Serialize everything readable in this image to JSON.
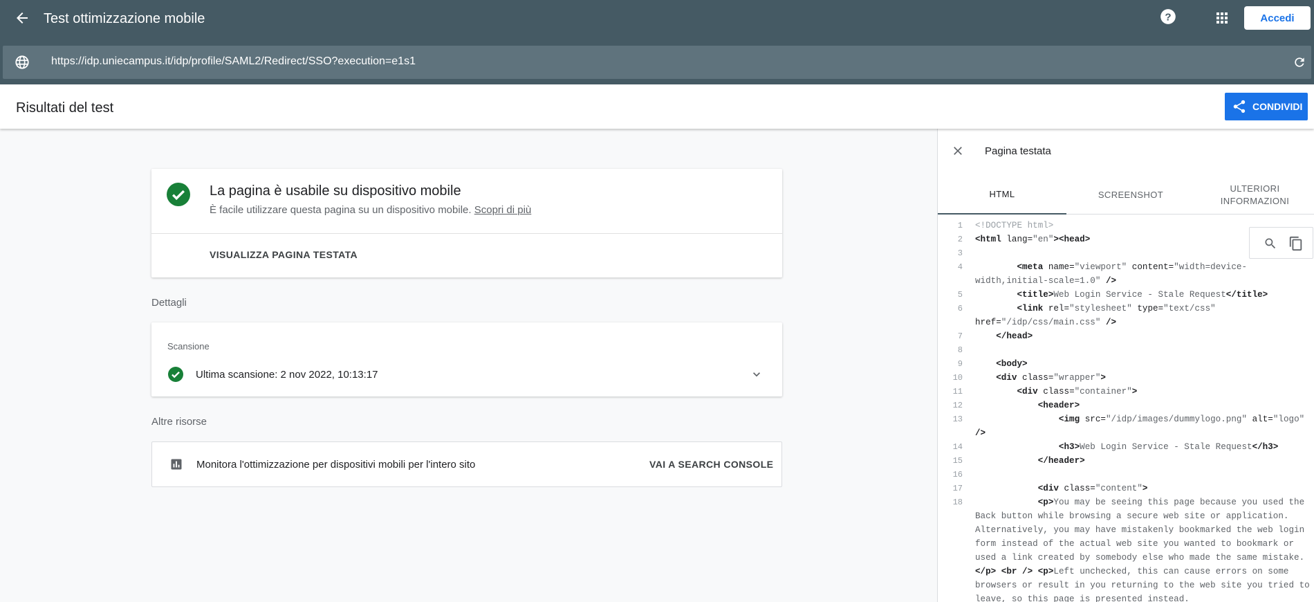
{
  "app": {
    "title": "Test ottimizzazione mobile",
    "signin_label": "Accedi"
  },
  "url_bar": {
    "url": "https://idp.uniecampus.it/idp/profile/SAML2/Redirect/SSO?execution=e1s1"
  },
  "results": {
    "title": "Risultati del test",
    "share_label": "CONDIVIDI"
  },
  "result_card": {
    "title": "La pagina è usabile su dispositivo mobile",
    "description": "È facile utilizzare questa pagina su un dispositivo mobile.",
    "learn_more": "Scopri di più",
    "view_tested_page": "VISUALIZZA PAGINA TESTATA"
  },
  "details": {
    "label": "Dettagli",
    "scan_label": "Scansione",
    "last_scan": "Ultima scansione: 2 nov 2022, 10:13:17"
  },
  "resources": {
    "label": "Altre risorse",
    "text": "Monitora l'ottimizzazione per dispositivi mobili per l'intero sito",
    "console_link": "VAI A SEARCH CONSOLE"
  },
  "panel": {
    "title": "Pagina testata",
    "tabs": [
      {
        "label": "HTML",
        "active": true
      },
      {
        "label": "SCREENSHOT",
        "active": false
      },
      {
        "label": "ULTERIORI INFORMAZIONI",
        "active": false
      }
    ]
  },
  "colors": {
    "header_bg": "#455a64",
    "accent": "#1a73e8",
    "success": "#188038"
  },
  "code_lines": [
    {
      "n": "1",
      "html": "<span class=\"doctype\">&lt;!DOCTYPE html&gt;</span>"
    },
    {
      "n": "2",
      "html": "<span class=\"tag\">&lt;html</span> <span class=\"attr\">lang</span>=<span class=\"val\">\"en\"</span><span class=\"tag\">&gt;&lt;head&gt;</span>"
    },
    {
      "n": "3",
      "html": ""
    },
    {
      "n": "4",
      "html": "        <span class=\"tag\">&lt;meta</span> <span class=\"attr\">name</span>=<span class=\"val\">\"viewport\"</span> <span class=\"attr\">content</span>=<span class=\"val\">\"width=device-width,initial-scale=1.0\"</span> <span class=\"tag\">/&gt;</span>"
    },
    {
      "n": "5",
      "html": "        <span class=\"tag\">&lt;title&gt;</span><span class=\"txt\">Web Login Service - Stale Request</span><span class=\"tag\">&lt;/title&gt;</span>"
    },
    {
      "n": "6",
      "html": "        <span class=\"tag\">&lt;link</span> <span class=\"attr\">rel</span>=<span class=\"val\">\"stylesheet\"</span> <span class=\"attr\">type</span>=<span class=\"val\">\"text/css\"</span> <span class=\"attr\">href</span>=<span class=\"val\">\"/idp/css/main.css\"</span> <span class=\"tag\">/&gt;</span>"
    },
    {
      "n": "7",
      "html": "    <span class=\"tag\">&lt;/head&gt;</span>"
    },
    {
      "n": "8",
      "html": ""
    },
    {
      "n": "9",
      "html": "    <span class=\"tag\">&lt;body&gt;</span>"
    },
    {
      "n": "10",
      "html": "    <span class=\"tag\">&lt;div</span> <span class=\"attr\">class</span>=<span class=\"val\">\"wrapper\"</span><span class=\"tag\">&gt;</span>"
    },
    {
      "n": "11",
      "html": "        <span class=\"tag\">&lt;div</span> <span class=\"attr\">class</span>=<span class=\"val\">\"container\"</span><span class=\"tag\">&gt;</span>"
    },
    {
      "n": "12",
      "html": "            <span class=\"tag\">&lt;header&gt;</span>"
    },
    {
      "n": "13",
      "html": "                <span class=\"tag\">&lt;img</span> <span class=\"attr\">src</span>=<span class=\"val\">\"/idp/images/dummylogo.png\"</span> <span class=\"attr\">alt</span>=<span class=\"val\">\"logo\"</span> <span class=\"tag\">/&gt;</span>"
    },
    {
      "n": "14",
      "html": "                <span class=\"tag\">&lt;h3&gt;</span><span class=\"txt\">Web Login Service - Stale Request</span><span class=\"tag\">&lt;/h3&gt;</span>"
    },
    {
      "n": "15",
      "html": "            <span class=\"tag\">&lt;/header&gt;</span>"
    },
    {
      "n": "16",
      "html": ""
    },
    {
      "n": "17",
      "html": "            <span class=\"tag\">&lt;div</span> <span class=\"attr\">class</span>=<span class=\"val\">\"content\"</span><span class=\"tag\">&gt;</span>"
    },
    {
      "n": "18",
      "html": "            <span class=\"tag\">&lt;p&gt;</span><span class=\"txt\">You may be seeing this page because you used the Back button while browsing a secure web site or application. Alternatively, you may have mistakenly bookmarked the web login form instead of the actual web site you wanted to bookmark or used a link created by somebody else who made the same mistake.</span><span class=\"tag\">&lt;/p&gt;</span> <span class=\"tag\">&lt;br /&gt;</span> <span class=\"tag\">&lt;p&gt;</span><span class=\"txt\">Left unchecked, this can cause errors on some browsers or result in you returning to the web site you tried to leave, so this page is presented instead.</span>"
    }
  ]
}
